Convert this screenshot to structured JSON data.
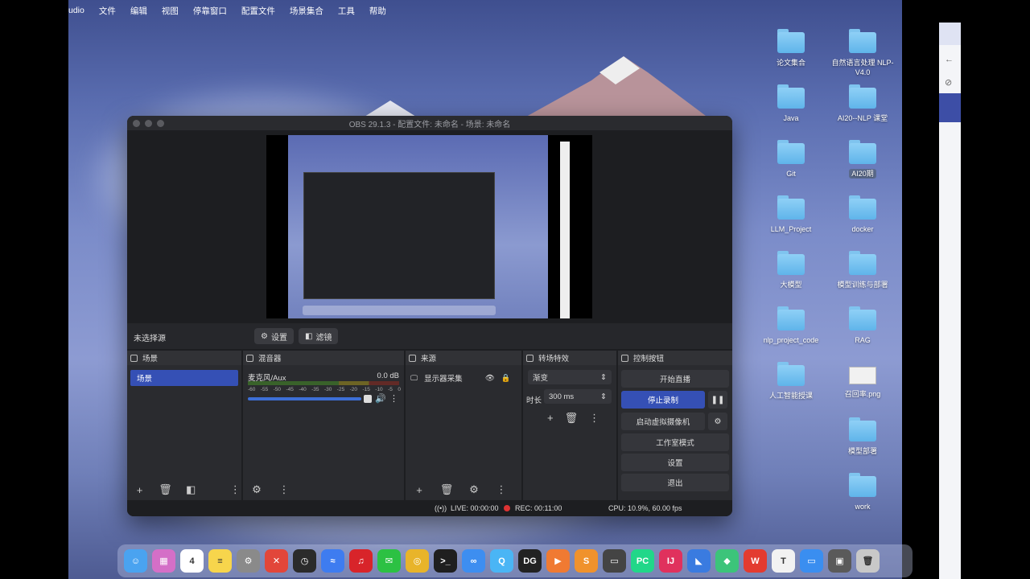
{
  "menubar": {
    "app": "udio",
    "items": [
      "文件",
      "编辑",
      "视图",
      "停靠窗口",
      "配置文件",
      "场景集合",
      "工具",
      "帮助"
    ]
  },
  "desktop_icons": [
    {
      "label": "论文集合",
      "kind": "folder"
    },
    {
      "label": "自然语言处理 NLP-V4.0",
      "kind": "folder"
    },
    {
      "label": "Java",
      "kind": "folder"
    },
    {
      "label": "AI20--NLP 课堂",
      "kind": "folder"
    },
    {
      "label": "Git",
      "kind": "folder"
    },
    {
      "label": "AI20期",
      "kind": "folder",
      "selected": true
    },
    {
      "label": "LLM_Project",
      "kind": "folder"
    },
    {
      "label": "docker",
      "kind": "folder"
    },
    {
      "label": "大模型",
      "kind": "folder"
    },
    {
      "label": "模型训练与部署",
      "kind": "folder"
    },
    {
      "label": "nlp_project_code",
      "kind": "folder"
    },
    {
      "label": "RAG",
      "kind": "folder"
    },
    {
      "label": "人工智能授课",
      "kind": "folder"
    },
    {
      "label": "召回率.png",
      "kind": "image"
    },
    {
      "label": "模型部署",
      "kind": "folder"
    },
    {
      "label": "work",
      "kind": "folder"
    }
  ],
  "obs": {
    "title": "OBS 29.1.3 - 配置文件: 未命名 - 场景: 未命名",
    "no_source": "未选择源",
    "settings_btn": "设置",
    "filters_btn": "滤镜",
    "docks": {
      "scenes": {
        "title": "场景",
        "items": [
          "场景"
        ]
      },
      "mixer": {
        "title": "混音器",
        "channel": "麦克风/Aux",
        "db": "0.0 dB",
        "ticks": [
          "-60",
          "-55",
          "-50",
          "-45",
          "-40",
          "-35",
          "-30",
          "-25",
          "-20",
          "-15",
          "-10",
          "-5",
          "0"
        ],
        "volume": 0.95
      },
      "sources": {
        "title": "来源",
        "items": [
          "显示器采集"
        ]
      },
      "transitions": {
        "title": "转场特效",
        "type": "渐变",
        "duration_label": "时长",
        "duration": "300 ms"
      },
      "controls": {
        "title": "控制按钮",
        "start_stream": "开始直播",
        "stop_record": "停止录制",
        "virtual_cam": "启动虚拟摄像机",
        "studio_mode": "工作室模式",
        "settings": "设置",
        "exit": "退出"
      }
    },
    "status": {
      "live": "LIVE: 00:00:00",
      "rec": "REC: 00:11:00",
      "cpu": "CPU: 10.9%, 60.00 fps"
    }
  },
  "dock_apps": [
    {
      "name": "Finder",
      "color": "#4aa3f0",
      "glyph": "☺"
    },
    {
      "name": "Launchpad",
      "color": "#d46fc7",
      "glyph": "▦"
    },
    {
      "name": "Calendar",
      "color": "#ffffff",
      "glyph": "4"
    },
    {
      "name": "Notes",
      "color": "#f7d54c",
      "glyph": "≡"
    },
    {
      "name": "System Settings",
      "color": "#8a8a8a",
      "glyph": "⚙"
    },
    {
      "name": "XMind",
      "color": "#e2463a",
      "glyph": "✕"
    },
    {
      "name": "Clock",
      "color": "#2b2b2b",
      "glyph": "◷"
    },
    {
      "name": "Lark",
      "color": "#3e7cf0",
      "glyph": "≈"
    },
    {
      "name": "NetEase Music",
      "color": "#d8242a",
      "glyph": "♫"
    },
    {
      "name": "WeChat",
      "color": "#2cc143",
      "glyph": "✉"
    },
    {
      "name": "Chrome",
      "color": "#e8b42a",
      "glyph": "◎"
    },
    {
      "name": "Terminal",
      "color": "#1f1f1f",
      "glyph": ">_"
    },
    {
      "name": "Baidu Netdisk",
      "color": "#3d8ef0",
      "glyph": "∞"
    },
    {
      "name": "QQ",
      "color": "#4ab5f5",
      "glyph": "Q"
    },
    {
      "name": "DataGrip",
      "color": "#222222",
      "glyph": "DG"
    },
    {
      "name": "Infuse",
      "color": "#f07a32",
      "glyph": "▶"
    },
    {
      "name": "Sublime Text",
      "color": "#f0922c",
      "glyph": "S"
    },
    {
      "name": "Screen",
      "color": "#444444",
      "glyph": "▭"
    },
    {
      "name": "PyCharm",
      "color": "#21d789",
      "glyph": "PC"
    },
    {
      "name": "IntelliJ",
      "color": "#e0315d",
      "glyph": "IJ"
    },
    {
      "name": "Cursor",
      "color": "#3a7be0",
      "glyph": "◣"
    },
    {
      "name": "Mirror",
      "color": "#3cc47a",
      "glyph": "◆"
    },
    {
      "name": "WPS",
      "color": "#e33b30",
      "glyph": "W"
    },
    {
      "name": "Typora",
      "color": "#f2f2f2",
      "glyph": "T"
    },
    {
      "name": "Messages",
      "color": "#3a8ef0",
      "glyph": "▭"
    },
    {
      "name": "Preview",
      "color": "#5a5a5a",
      "glyph": "▣"
    },
    {
      "name": "Trash",
      "color": "#c8c8c8",
      "glyph": "🗑"
    }
  ],
  "colors": {
    "accent": "#3550b5",
    "rec": "#dd3333"
  }
}
